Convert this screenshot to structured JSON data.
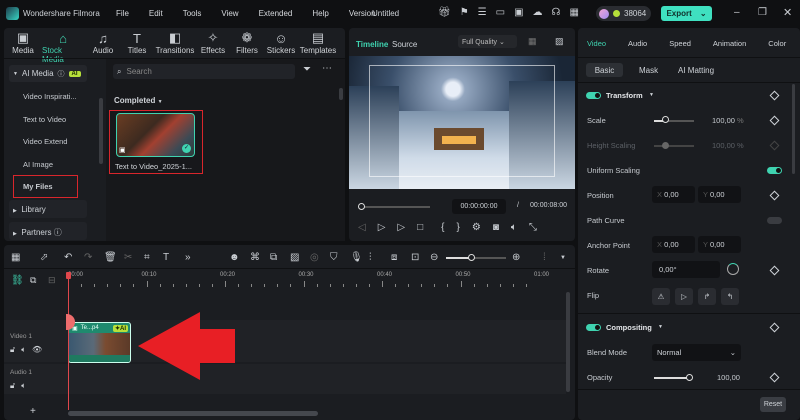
{
  "app": {
    "name": "Wondershare Filmora",
    "project": "Untitled",
    "credits": "38064",
    "export": "Export"
  },
  "menu": [
    "File",
    "Edit",
    "Tools",
    "View",
    "Extended",
    "Help",
    "Version"
  ],
  "toolbar": [
    {
      "label": "Media",
      "icon": "media-icon"
    },
    {
      "label": "Stock Media",
      "icon": "stock-media-icon"
    },
    {
      "label": "Audio",
      "icon": "audio-icon"
    },
    {
      "label": "Titles",
      "icon": "titles-icon"
    },
    {
      "label": "Transitions",
      "icon": "transitions-icon"
    },
    {
      "label": "Effects",
      "icon": "effects-icon"
    },
    {
      "label": "Filters",
      "icon": "filters-icon"
    },
    {
      "label": "Stickers",
      "icon": "stickers-icon"
    },
    {
      "label": "Templates",
      "icon": "templates-icon"
    }
  ],
  "sidebar": {
    "group": "AI Media",
    "badge": "AI",
    "items": [
      "Video Inspirati...",
      "Text to Video",
      "Video Extend",
      "AI Image",
      "My Files"
    ],
    "library": "Library",
    "partners": "Partners"
  },
  "media": {
    "search_placeholder": "Search",
    "section": "Completed",
    "clip_name": "Text to Video_2025-1..."
  },
  "preview": {
    "tab_timeline": "Timeline",
    "tab_source": "Source",
    "quality": "Full Quality",
    "current_time": "00:00:00:00",
    "separator": "/",
    "total_time": "00:00:08:00"
  },
  "props": {
    "tabs": [
      "Video",
      "Audio",
      "Speed",
      "Animation",
      "Color"
    ],
    "subtabs": [
      "Basic",
      "Mask",
      "AI Matting"
    ],
    "transform": "Transform",
    "scale": "Scale",
    "scale_val": "100,00",
    "pct": "%",
    "height_scaling": "Height Scaling",
    "height_val": "100,00",
    "uniform": "Uniform Scaling",
    "position": "Position",
    "x": "X",
    "y": "Y",
    "pos_x": "0,00",
    "pos_y": "0,00",
    "path_curve": "Path Curve",
    "anchor": "Anchor Point",
    "anc_x": "0,00",
    "anc_y": "0,00",
    "rotate": "Rotate",
    "rotate_val": "0,00°",
    "flip": "Flip",
    "compositing": "Compositing",
    "blend": "Blend Mode",
    "blend_val": "Normal",
    "opacity": "Opacity",
    "opacity_val": "100,00",
    "reset": "Reset"
  },
  "timeline": {
    "ticks": [
      "00:00",
      "00:10",
      "00:20",
      "00:30",
      "00:40",
      "00:50",
      "01:00"
    ],
    "video_track": "Video 1",
    "audio_track": "Audio 1",
    "clip_label": "Te...p4",
    "clip_badge": "AI",
    "add": "+"
  }
}
